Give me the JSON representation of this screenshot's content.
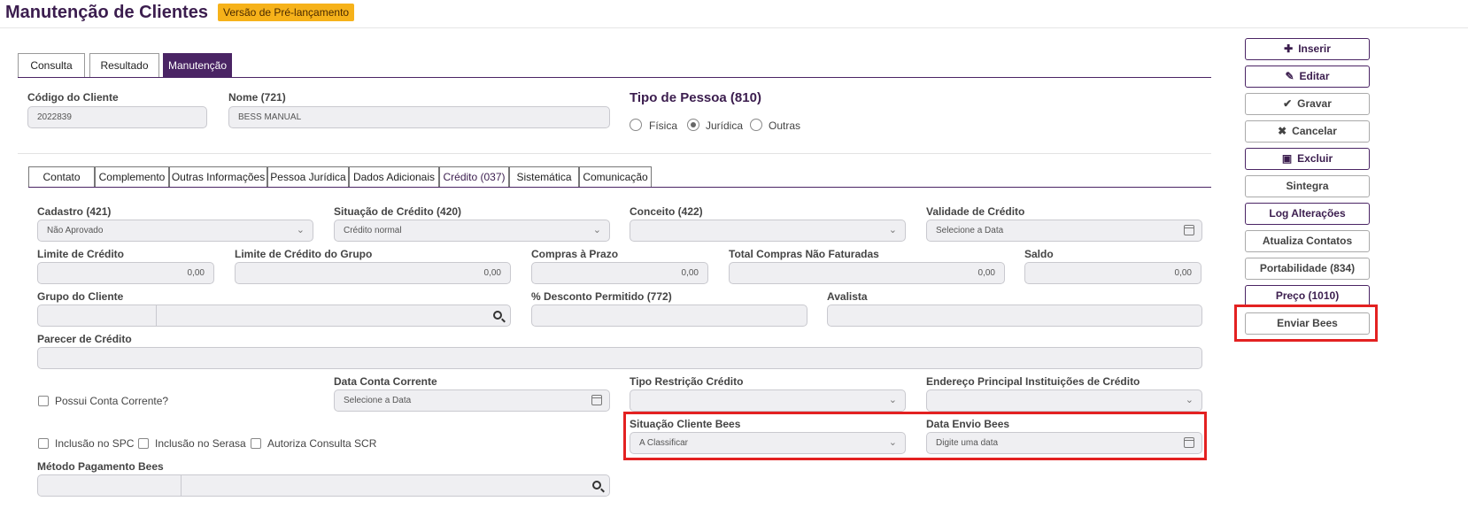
{
  "header": {
    "title": "Manutenção de Clientes",
    "badge": "Versão de Pré-lançamento",
    "badge_color": "#f6b21a"
  },
  "main_tabs": [
    {
      "label": "Consulta",
      "active": false
    },
    {
      "label": "Resultado",
      "active": false
    },
    {
      "label": "Manutenção",
      "active": true
    }
  ],
  "client": {
    "code_label": "Código do Cliente",
    "code_value": "2022839",
    "name_label": "Nome (721)",
    "name_value": "BESS MANUAL",
    "tipo_label": "Tipo de Pessoa (810)",
    "tipo_options": [
      {
        "label": "Física",
        "selected": false
      },
      {
        "label": "Jurídica",
        "selected": true
      },
      {
        "label": "Outras",
        "selected": false
      }
    ]
  },
  "sub_tabs": [
    {
      "label": "Contato"
    },
    {
      "label": "Complemento"
    },
    {
      "label": "Outras Informações"
    },
    {
      "label": "Pessoa Jurídica"
    },
    {
      "label": "Dados Adicionais"
    },
    {
      "label": "Crédito (037)",
      "active": true
    },
    {
      "label": "Sistemática"
    },
    {
      "label": "Comunicação"
    }
  ],
  "credit": {
    "cadastro_label": "Cadastro (421)",
    "cadastro_value": "Não Aprovado",
    "situacao_label": "Situação de Crédito (420)",
    "situacao_value": "Crédito normal",
    "conceito_label": "Conceito (422)",
    "conceito_value": "",
    "validade_label": "Validade de Crédito",
    "validade_placeholder": "Selecione a Data",
    "limite_label": "Limite de Crédito",
    "limite_value": "0,00",
    "limite_grupo_label": "Limite de Crédito do Grupo",
    "limite_grupo_value": "0,00",
    "compras_label": "Compras à Prazo",
    "compras_value": "0,00",
    "total_nf_label": "Total Compras Não Faturadas",
    "total_nf_value": "0,00",
    "saldo_label": "Saldo",
    "saldo_value": "0,00",
    "grupo_label": "Grupo do Cliente",
    "desconto_label": "% Desconto Permitido (772)",
    "avalista_label": "Avalista",
    "parecer_label": "Parecer de Crédito",
    "possui_cc_label": "Possui Conta Corrente?",
    "data_cc_label": "Data Conta Corrente",
    "data_cc_placeholder": "Selecione a Data",
    "tipo_restricao_label": "Tipo Restrição Crédito",
    "endereco_label": "Endereço Principal Instituições de Crédito",
    "situacao_bees_label": "Situação Cliente Bees",
    "situacao_bees_value": "A Classificar",
    "data_envio_label": "Data Envio Bees",
    "data_envio_placeholder": "Digite uma data",
    "spc_label": "Inclusão no SPC",
    "serasa_label": "Inclusão no Serasa",
    "scr_label": "Autoriza Consulta SCR",
    "metodo_label": "Método Pagamento Bees"
  },
  "actions": [
    {
      "label": "Inserir",
      "icon": "plus-icon",
      "primary": true
    },
    {
      "label": "Editar",
      "icon": "edit-icon",
      "primary": true
    },
    {
      "label": "Gravar",
      "icon": "check-icon",
      "primary": false
    },
    {
      "label": "Cancelar",
      "icon": "times-icon",
      "primary": false
    },
    {
      "label": "Excluir",
      "icon": "trash-icon",
      "primary": true
    },
    {
      "label": "Sintegra",
      "primary": false
    },
    {
      "label": "Log Alterações",
      "primary": true
    },
    {
      "label": "Atualiza Contatos",
      "primary": false
    },
    {
      "label": "Portabilidade (834)",
      "primary": false
    },
    {
      "label": "Preço (1010)",
      "primary": true
    },
    {
      "label": "Enviar Bees",
      "primary": false
    }
  ],
  "highlight_color": "#e32121"
}
